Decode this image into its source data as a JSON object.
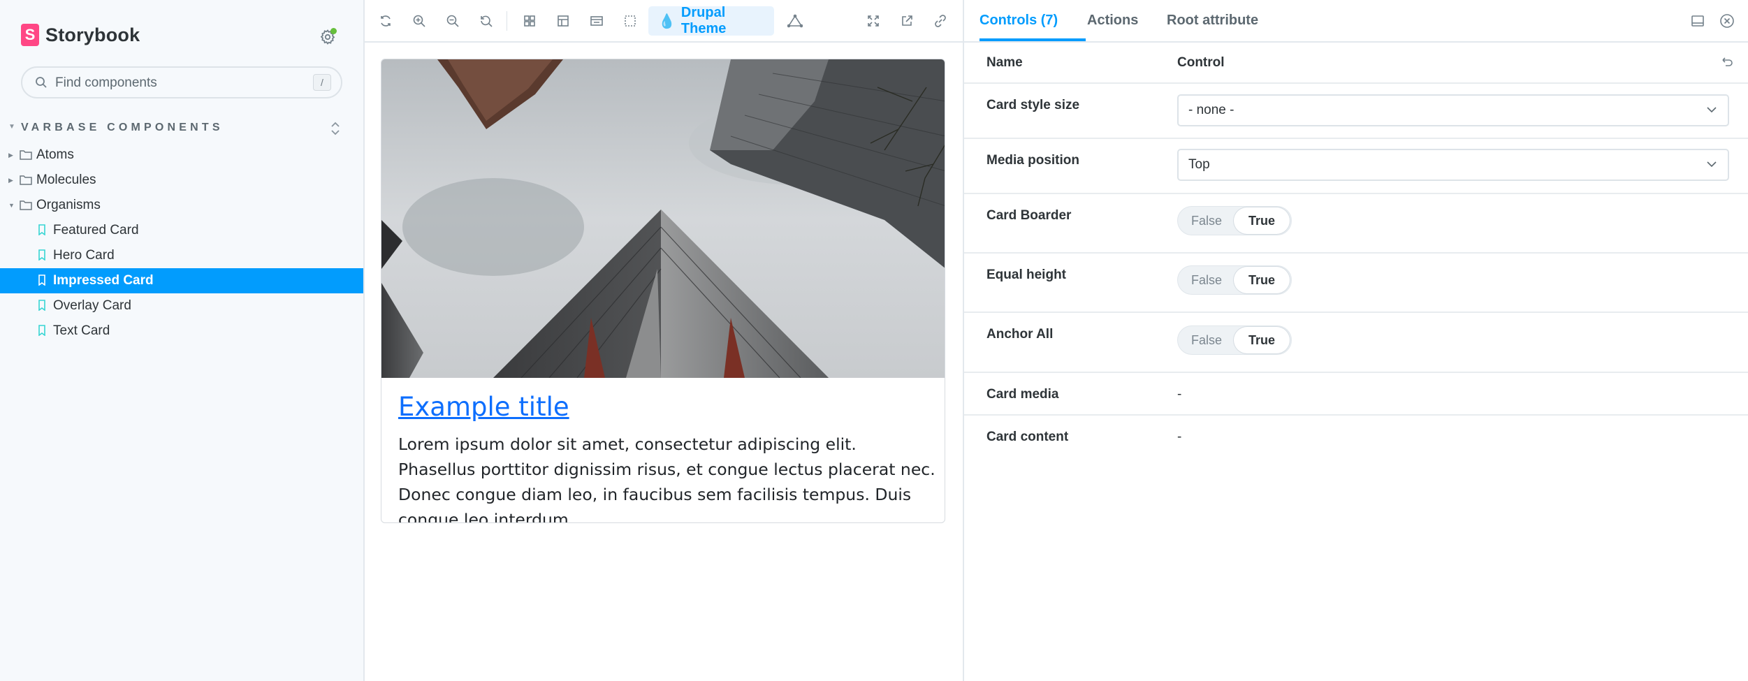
{
  "app": {
    "name": "Storybook",
    "logo_letter": "S"
  },
  "search": {
    "placeholder": "Find components",
    "shortcut": "/"
  },
  "sidebar": {
    "section_title": "VARBASE COMPONENTS",
    "groups": [
      {
        "label": "Atoms"
      },
      {
        "label": "Molecules"
      },
      {
        "label": "Organisms"
      }
    ],
    "stories": [
      {
        "label": "Featured Card"
      },
      {
        "label": "Hero Card"
      },
      {
        "label": "Impressed Card"
      },
      {
        "label": "Overlay Card"
      },
      {
        "label": "Text Card"
      }
    ]
  },
  "toolbar": {
    "theme_label": "Drupal Theme"
  },
  "card": {
    "title": "Example title",
    "text": "Lorem ipsum dolor sit amet, consectetur adipiscing elit. Phasellus porttitor dignissim risus, et congue lectus placerat nec. Donec congue diam leo, in faucibus sem facilisis tempus. Duis congue leo interdum"
  },
  "panel": {
    "tabs": [
      {
        "label": "Controls (7)"
      },
      {
        "label": "Actions"
      },
      {
        "label": "Root attribute"
      }
    ],
    "header": {
      "name": "Name",
      "control": "Control"
    },
    "controls": {
      "card_style_size": {
        "label": "Card style size",
        "value": "- none -"
      },
      "media_position": {
        "label": "Media position",
        "value": "Top"
      },
      "card_boarder": {
        "label": "Card Boarder",
        "false_label": "False",
        "true_label": "True"
      },
      "equal_height": {
        "label": "Equal height",
        "false_label": "False",
        "true_label": "True"
      },
      "anchor_all": {
        "label": "Anchor All",
        "false_label": "False",
        "true_label": "True"
      },
      "card_media": {
        "label": "Card media",
        "value": "-"
      },
      "card_content": {
        "label": "Card content",
        "value": "-"
      }
    }
  },
  "colors": {
    "accent": "#029cfd",
    "brand": "#ff4785",
    "link": "#0d6efd",
    "sidebar_bg": "#f6f9fc",
    "status_dot": "#66bf3c"
  },
  "icons": {
    "toolbar": [
      "reload-icon",
      "zoom-in-icon",
      "zoom-out-icon",
      "zoom-reset-icon",
      "grid-icon",
      "background-icon",
      "viewport-icon",
      "outline-icon",
      "theme-drop-icon",
      "measure-icon",
      "fullscreen-icon",
      "open-new-tab-icon",
      "copy-link-icon"
    ],
    "panel": [
      "panel-position-icon",
      "close-panel-icon",
      "reset-controls-icon"
    ]
  }
}
